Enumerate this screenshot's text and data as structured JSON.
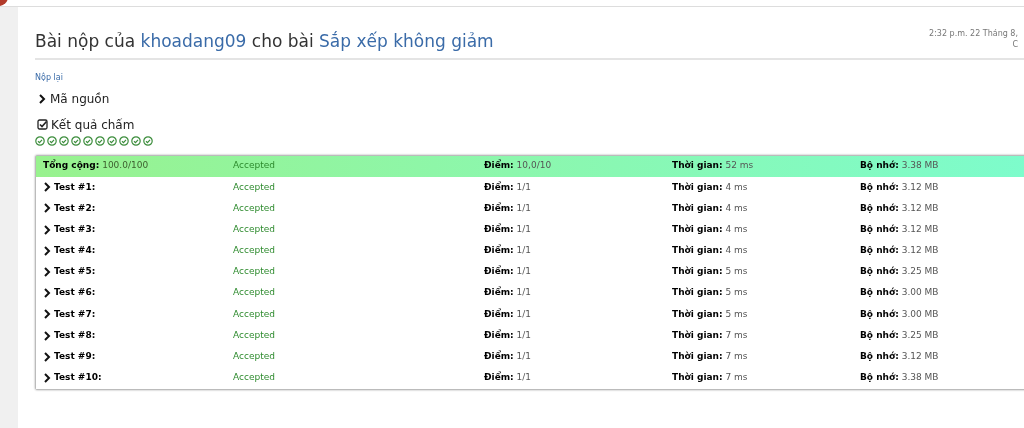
{
  "header": {
    "title_prefix": "Bài nộp của",
    "user": "khoadang09",
    "title_middle": "cho bài",
    "problem": "Sắp xếp không giảm",
    "timestamp": "2:32 p.m. 22 Tháng 8,",
    "timestamp_line_2": "C"
  },
  "resubmit_link": "Nộp lại",
  "source_section": {
    "label": "Mã nguồn",
    "expanded": false
  },
  "results_section": {
    "label": "Kết quả chấm",
    "checked": true
  },
  "case_icons": [
    {
      "kind": "accepted"
    },
    {
      "kind": "accepted"
    },
    {
      "kind": "accepted"
    },
    {
      "kind": "accepted"
    },
    {
      "kind": "accepted"
    },
    {
      "kind": "accepted"
    },
    {
      "kind": "accepted"
    },
    {
      "kind": "accepted"
    },
    {
      "kind": "accepted"
    },
    {
      "kind": "accepted"
    }
  ],
  "summary": {
    "label": "Tổng cộng:",
    "value": "100.0/100",
    "status": "Accepted",
    "points_label": "Điểm:",
    "points": "10,0/10",
    "time_label": "Thời gian:",
    "time": "52 ms",
    "memory_label": "Bộ nhớ:",
    "memory": "3.38 MB"
  },
  "tests": [
    {
      "label": "Test #1:",
      "expanded": false,
      "status": "Accepted",
      "points_label": "Điểm:",
      "points": "1/1",
      "time_label": "Thời gian:",
      "time": "4 ms",
      "memory_label": "Bộ nhớ:",
      "memory": "3.12 MB"
    },
    {
      "label": "Test #2:",
      "expanded": false,
      "status": "Accepted",
      "points_label": "Điểm:",
      "points": "1/1",
      "time_label": "Thời gian:",
      "time": "4 ms",
      "memory_label": "Bộ nhớ:",
      "memory": "3.12 MB"
    },
    {
      "label": "Test #3:",
      "expanded": false,
      "status": "Accepted",
      "points_label": "Điểm:",
      "points": "1/1",
      "time_label": "Thời gian:",
      "time": "4 ms",
      "memory_label": "Bộ nhớ:",
      "memory": "3.12 MB"
    },
    {
      "label": "Test #4:",
      "expanded": false,
      "status": "Accepted",
      "points_label": "Điểm:",
      "points": "1/1",
      "time_label": "Thời gian:",
      "time": "4 ms",
      "memory_label": "Bộ nhớ:",
      "memory": "3.12 MB"
    },
    {
      "label": "Test #5:",
      "expanded": false,
      "status": "Accepted",
      "points_label": "Điểm:",
      "points": "1/1",
      "time_label": "Thời gian:",
      "time": "5 ms",
      "memory_label": "Bộ nhớ:",
      "memory": "3.25 MB"
    },
    {
      "label": "Test #6:",
      "expanded": false,
      "status": "Accepted",
      "points_label": "Điểm:",
      "points": "1/1",
      "time_label": "Thời gian:",
      "time": "5 ms",
      "memory_label": "Bộ nhớ:",
      "memory": "3.00 MB"
    },
    {
      "label": "Test #7:",
      "expanded": false,
      "status": "Accepted",
      "points_label": "Điểm:",
      "points": "1/1",
      "time_label": "Thời gian:",
      "time": "5 ms",
      "memory_label": "Bộ nhớ:",
      "memory": "3.00 MB"
    },
    {
      "label": "Test #8:",
      "expanded": false,
      "status": "Accepted",
      "points_label": "Điểm:",
      "points": "1/1",
      "time_label": "Thời gian:",
      "time": "7 ms",
      "memory_label": "Bộ nhớ:",
      "memory": "3.25 MB"
    },
    {
      "label": "Test #9:",
      "expanded": false,
      "status": "Accepted",
      "points_label": "Điểm:",
      "points": "1/1",
      "time_label": "Thời gian:",
      "time": "7 ms",
      "memory_label": "Bộ nhớ:",
      "memory": "3.12 MB"
    },
    {
      "label": "Test #10:",
      "expanded": false,
      "status": "Accepted",
      "points_label": "Điểm:",
      "points": "1/1",
      "time_label": "Thời gian:",
      "time": "7 ms",
      "memory_label": "Bộ nhớ:",
      "memory": "3.38 MB"
    }
  ]
}
